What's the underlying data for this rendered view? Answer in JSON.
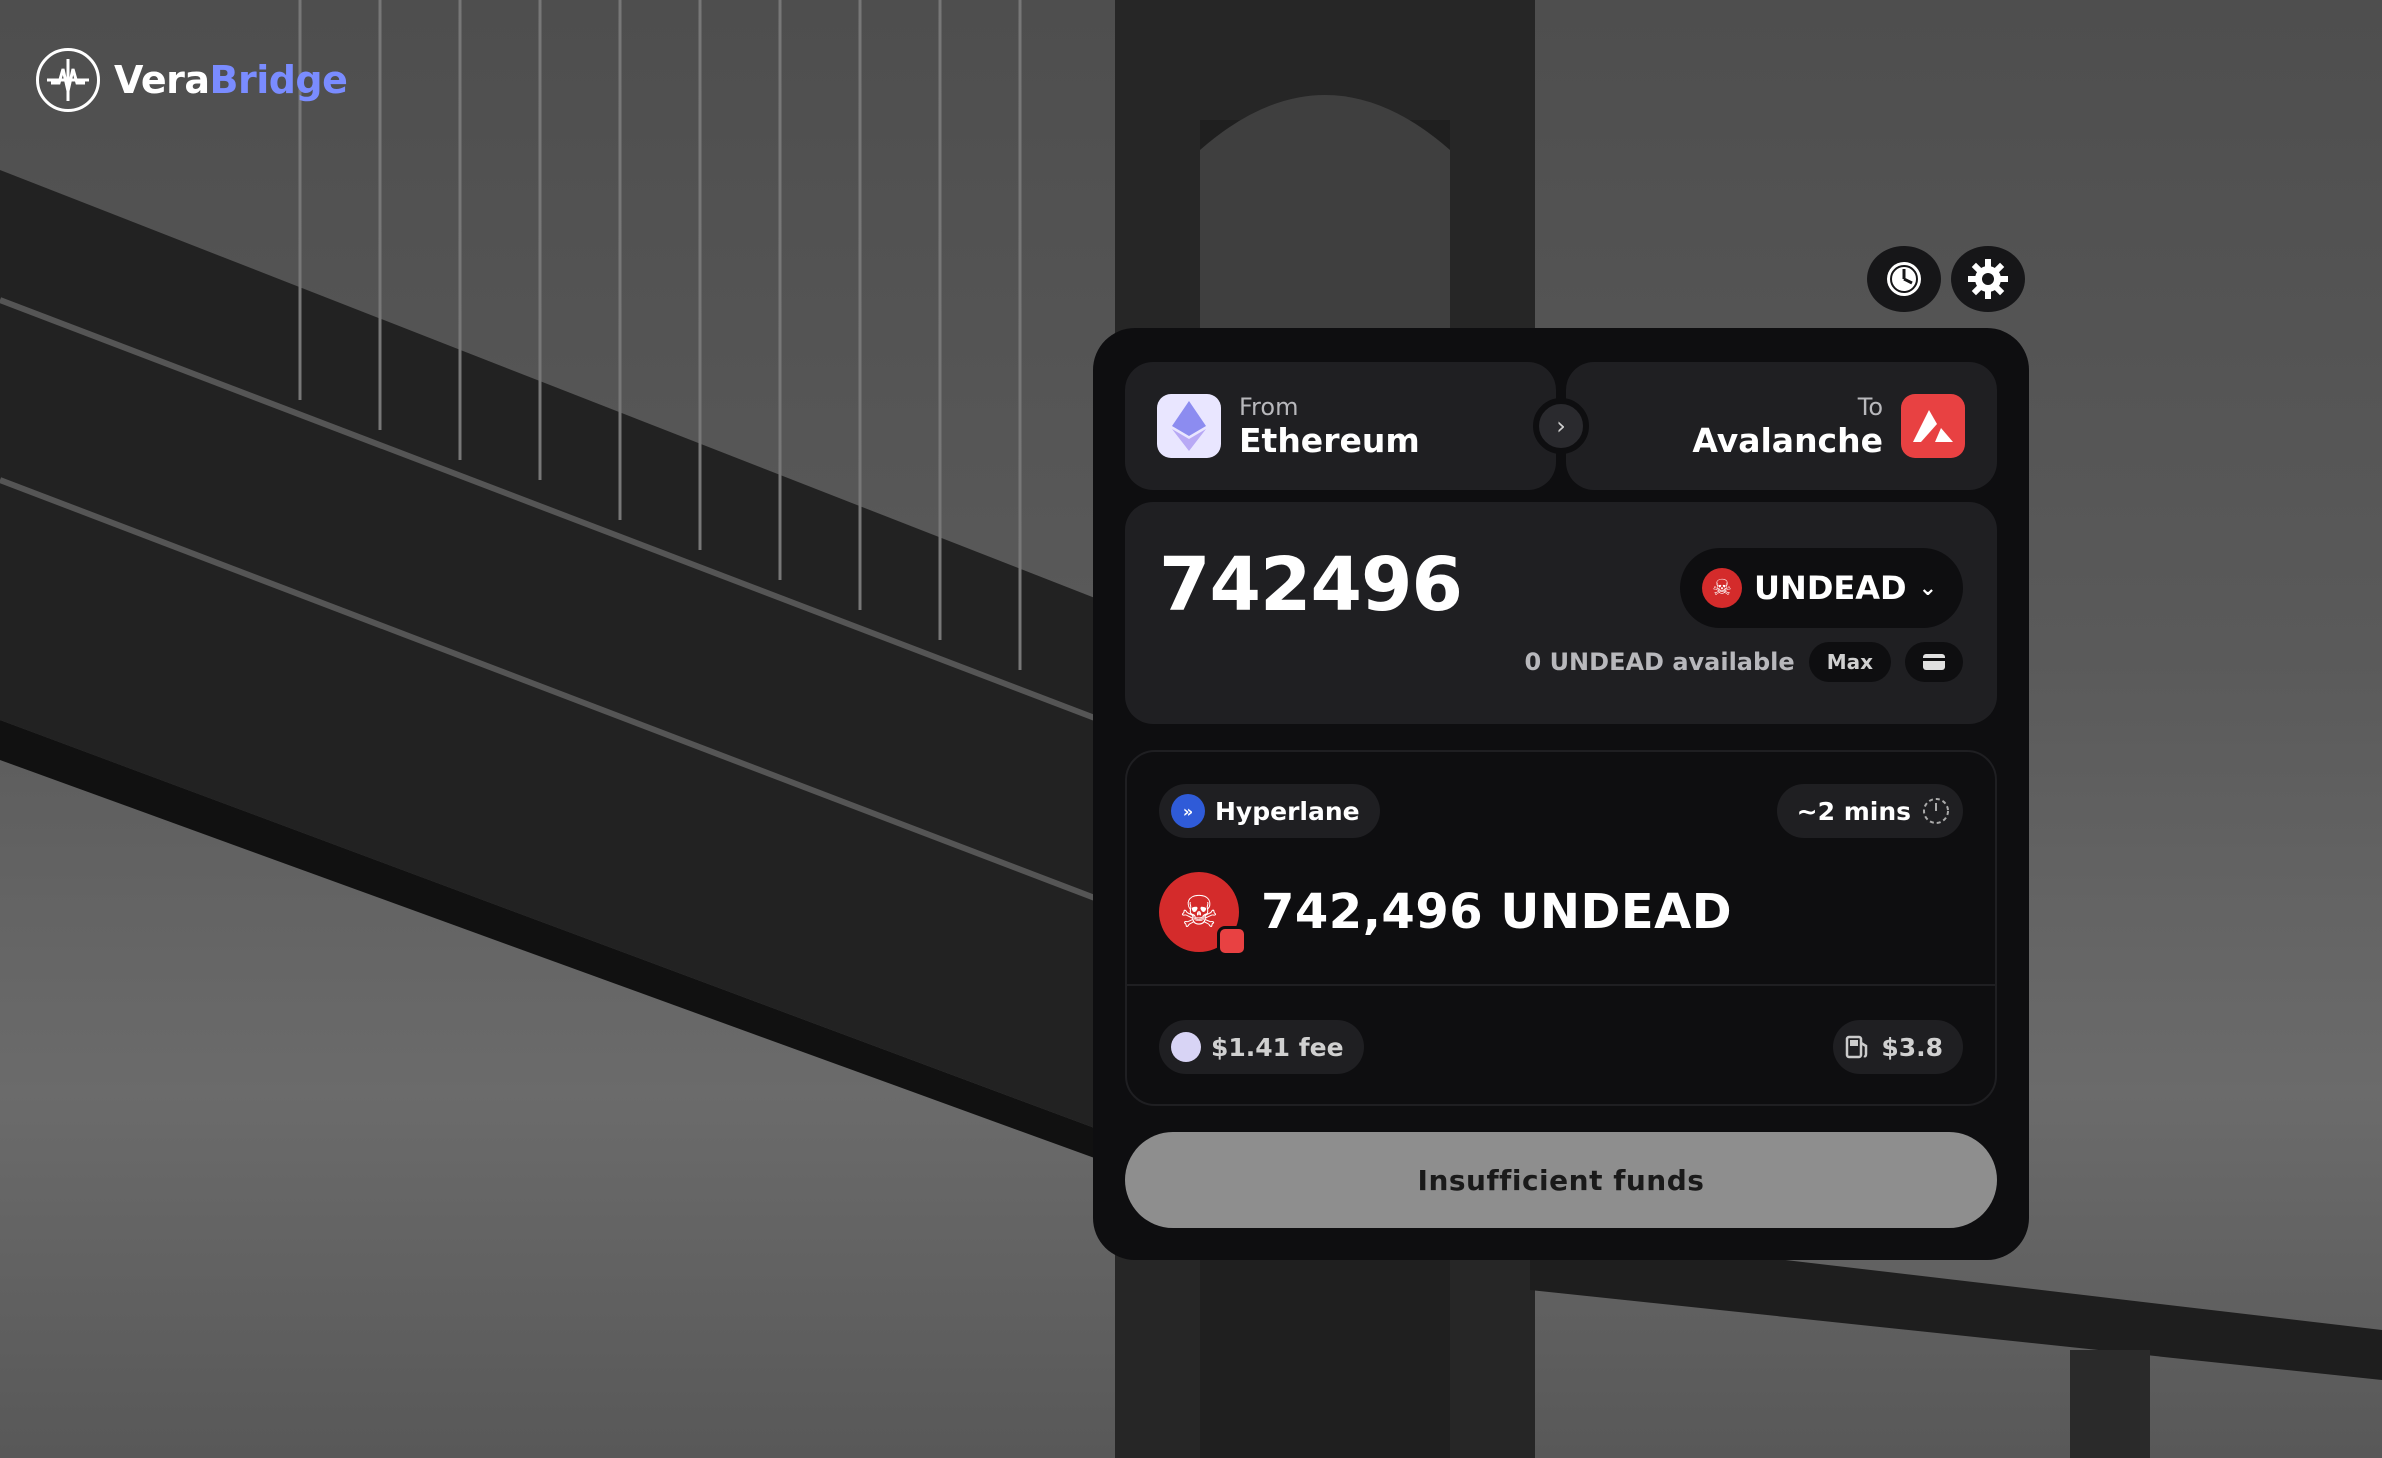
{
  "brand": {
    "name_part1": "Vera",
    "name_part2": "Bridge"
  },
  "header": {
    "history_icon": "clock-icon",
    "settings_icon": "gear-icon"
  },
  "from_chain": {
    "label": "From",
    "name": "Ethereum",
    "icon": "ethereum-icon"
  },
  "to_chain": {
    "label": "To",
    "name": "Avalanche",
    "icon": "avalanche-icon"
  },
  "swap_icon": "chevron-right-icon",
  "amount": {
    "value": "742496"
  },
  "token": {
    "symbol": "UNDEAD",
    "icon": "skull-icon"
  },
  "balance": {
    "available_text": "0 UNDEAD available",
    "max_label": "Max",
    "wallet_icon": "wallet-icon"
  },
  "route": {
    "provider": "Hyperlane",
    "eta": "~2 mins",
    "receive_amount": "742,496 UNDEAD",
    "fee": "$1.41 fee",
    "gas": "$3.8"
  },
  "submit_label": "Insufficient funds",
  "colors": {
    "brand_accent": "#7a8cff",
    "card_bg": "#0e0e10",
    "panel_bg": "#1f1f22",
    "avalanche_red": "#e84142",
    "token_red": "#d42b2b",
    "disabled_button": "#8e8e8e"
  }
}
